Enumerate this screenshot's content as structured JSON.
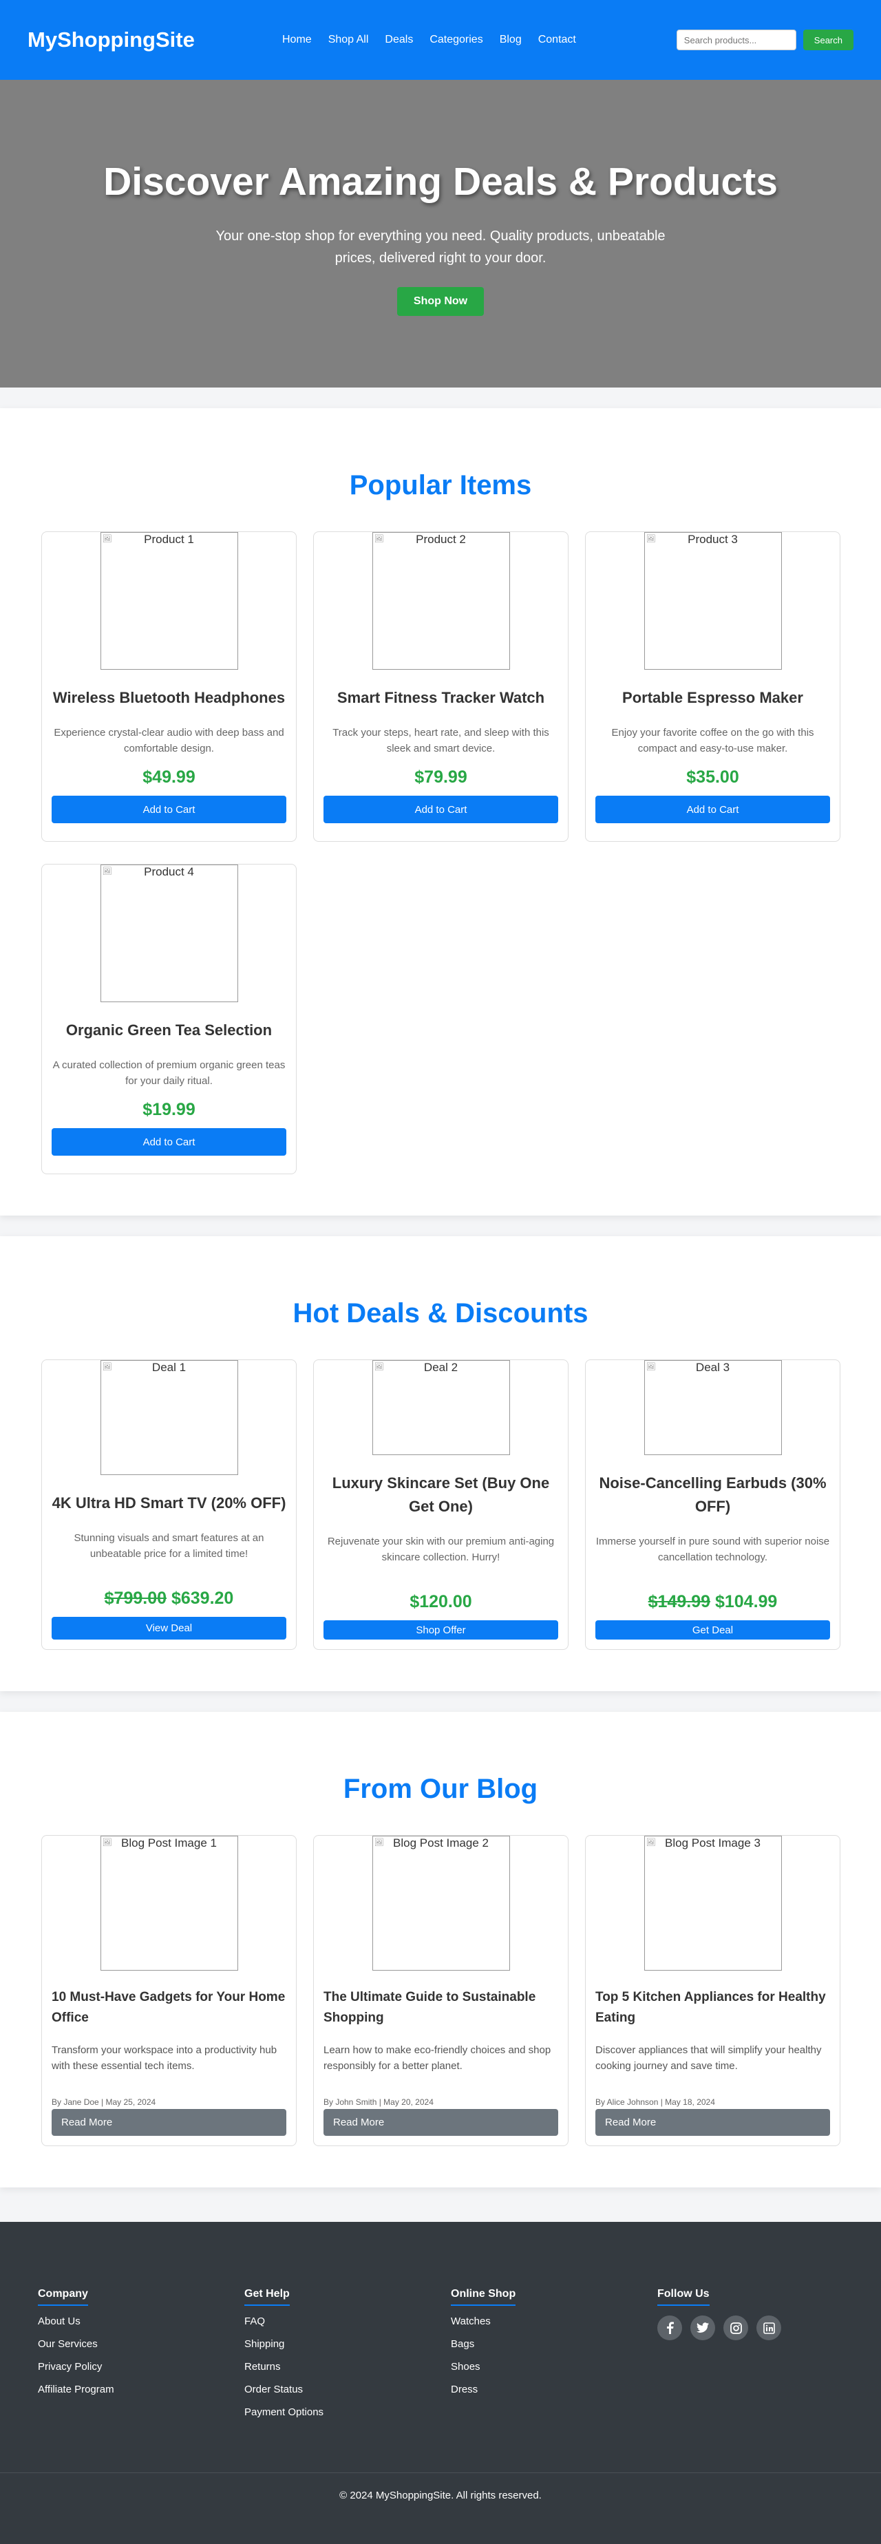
{
  "header": {
    "logo": "MyShoppingSite",
    "nav": [
      "Home",
      "Shop All",
      "Deals",
      "Categories",
      "Blog",
      "Contact"
    ],
    "search_placeholder": "Search products...",
    "search_button": "Search"
  },
  "hero": {
    "title": "Discover Amazing Deals & Products",
    "subtitle": "Your one-stop shop for everything you need. Quality products, unbeatable prices, delivered right to your door.",
    "button": "Shop Now"
  },
  "popular": {
    "title": "Popular Items",
    "items": [
      {
        "img_alt": "Product 1",
        "name": "Wireless Bluetooth Headphones",
        "desc": "Experience crystal-clear audio with deep bass and comfortable design.",
        "price": "$49.99",
        "button": "Add to Cart"
      },
      {
        "img_alt": "Product 2",
        "name": "Smart Fitness Tracker Watch",
        "desc": "Track your steps, heart rate, and sleep with this sleek and smart device.",
        "price": "$79.99",
        "button": "Add to Cart"
      },
      {
        "img_alt": "Product 3",
        "name": "Portable Espresso Maker",
        "desc": "Enjoy your favorite coffee on the go with this compact and easy-to-use maker.",
        "price": "$35.00",
        "button": "Add to Cart"
      },
      {
        "img_alt": "Product 4",
        "name": "Organic Green Tea Selection",
        "desc": "A curated collection of premium organic green teas for your daily ritual.",
        "price": "$19.99",
        "button": "Add to Cart"
      }
    ]
  },
  "deals": {
    "title": "Hot Deals & Discounts",
    "items": [
      {
        "img_alt": "Deal 1",
        "name": "4K Ultra HD Smart TV (20% OFF)",
        "desc": "Stunning visuals and smart features at an unbeatable price for a limited time!",
        "old_price": "$799.00",
        "price": "$639.20",
        "button": "View Deal"
      },
      {
        "img_alt": "Deal 2",
        "name": "Luxury Skincare Set (Buy One Get One)",
        "desc": "Rejuvenate your skin with our premium anti-aging skincare collection. Hurry!",
        "old_price": "",
        "price": "$120.00",
        "button": "Shop Offer"
      },
      {
        "img_alt": "Deal 3",
        "name": "Noise-Cancelling Earbuds (30% OFF)",
        "desc": "Immerse yourself in pure sound with superior noise cancellation technology.",
        "old_price": "$149.99",
        "price": "$104.99",
        "button": "Get Deal"
      }
    ]
  },
  "blog": {
    "title": "From Our Blog",
    "posts": [
      {
        "img_alt": "Blog Post Image 1",
        "title": "10 Must-Have Gadgets for Your Home Office",
        "desc": "Transform your workspace into a productivity hub with these essential tech items.",
        "meta": "By Jane Doe | May 25, 2024",
        "button": "Read More"
      },
      {
        "img_alt": "Blog Post Image 2",
        "title": "The Ultimate Guide to Sustainable Shopping",
        "desc": "Learn how to make eco-friendly choices and shop responsibly for a better planet.",
        "meta": "By John Smith | May 20, 2024",
        "button": "Read More"
      },
      {
        "img_alt": "Blog Post Image 3",
        "title": "Top 5 Kitchen Appliances for Healthy Eating",
        "desc": "Discover appliances that will simplify your healthy cooking journey and save time.",
        "meta": "By Alice Johnson | May 18, 2024",
        "button": "Read More"
      }
    ]
  },
  "footer": {
    "columns": [
      {
        "heading": "Company",
        "links": [
          "About Us",
          "Our Services",
          "Privacy Policy",
          "Affiliate Program"
        ]
      },
      {
        "heading": "Get Help",
        "links": [
          "FAQ",
          "Shipping",
          "Returns",
          "Order Status",
          "Payment Options"
        ]
      },
      {
        "heading": "Online Shop",
        "links": [
          "Watches",
          "Bags",
          "Shoes",
          "Dress"
        ]
      }
    ],
    "follow_heading": "Follow Us",
    "socials": [
      "facebook-icon",
      "twitter-icon",
      "instagram-icon",
      "linkedin-icon"
    ],
    "copyright": "© 2024 MyShoppingSite. All rights reserved."
  },
  "colors": {
    "primary": "#0a7cf5",
    "success": "#28a745",
    "secondary": "#6c757d",
    "footer": "#343a40"
  }
}
